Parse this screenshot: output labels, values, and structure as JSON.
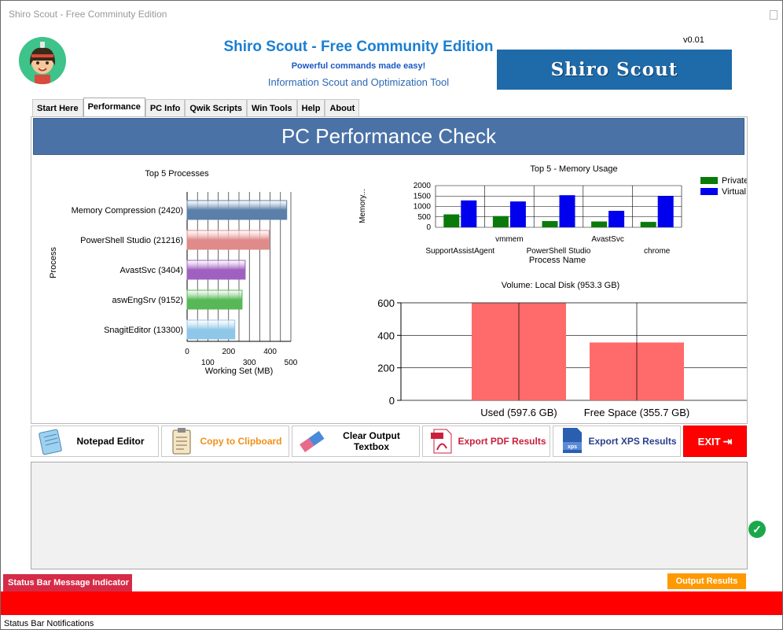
{
  "window": {
    "title": "Shiro Scout - Free Comminuty Edition"
  },
  "header": {
    "title": "Shiro Scout - Free Community Edition",
    "subtitle": "Powerful commands made easy!",
    "description": "Information Scout and Optimization Tool",
    "version": "v0.01",
    "brand": "Shiro Scout"
  },
  "tabs": [
    {
      "label": "Start Here",
      "active": false
    },
    {
      "label": "Performance",
      "active": true
    },
    {
      "label": "PC Info",
      "active": false
    },
    {
      "label": "Qwik Scripts",
      "active": false
    },
    {
      "label": "Win Tools",
      "active": false
    },
    {
      "label": "Help",
      "active": false
    },
    {
      "label": "About",
      "active": false
    }
  ],
  "panel": {
    "banner": "PC Performance Check"
  },
  "chart_data": [
    {
      "type": "bar",
      "orientation": "horizontal",
      "title": "Top 5 Processes",
      "xlabel": "Working Set (MB)",
      "ylabel": "Process",
      "categories": [
        "Memory Compression (2420)",
        "PowerShell Studio (21216)",
        "AvastSvc (3404)",
        "aswEngSrv (9152)",
        "SnagitEditor (13300)"
      ],
      "values": [
        480,
        395,
        280,
        265,
        230
      ],
      "colors": [
        "#5a7fa8",
        "#e08a8a",
        "#a060c0",
        "#58b858",
        "#8fc7e8"
      ],
      "xlim": [
        0,
        500
      ],
      "xticks_top": [
        "0",
        "200",
        "400"
      ],
      "xticks_bottom": [
        "100",
        "300",
        "500"
      ]
    },
    {
      "type": "bar",
      "title": "Top 5 - Memory Usage",
      "xlabel": "Process Name",
      "ylabel": "Memory...",
      "categories": [
        "SupportAssistAgent",
        "vmmem",
        "PowerShell Studio",
        "AvastSvc",
        "chrome"
      ],
      "series": [
        {
          "name": "Private",
          "color": "#0a7a0a",
          "values": [
            620,
            540,
            300,
            280,
            260
          ]
        },
        {
          "name": "Virtual",
          "color": "#0000ee",
          "values": [
            1290,
            1240,
            1540,
            790,
            1500
          ]
        }
      ],
      "ylim": [
        0,
        2000
      ],
      "yticks": [
        "2000",
        "1500",
        "1000",
        "500",
        "0"
      ],
      "legend": "top-right"
    },
    {
      "type": "bar",
      "title": "Volume: Local Disk (953.3 GB)",
      "categories": [
        "Used (597.6 GB)",
        "Free Space (355.7 GB)"
      ],
      "values": [
        597.6,
        355.7
      ],
      "color": "#ff6a6a",
      "ylim": [
        0,
        600
      ],
      "yticks": [
        "600",
        "400",
        "200",
        "0"
      ]
    }
  ],
  "buttons": {
    "notepad": {
      "label": "Notepad Editor",
      "color": "#000000"
    },
    "clipboard": {
      "label": "Copy to Clipboard",
      "color": "#f0901a"
    },
    "clear": {
      "label": "Clear Output Textbox",
      "color": "#000000"
    },
    "pdf": {
      "label": "Export PDF Results",
      "color": "#c8203c"
    },
    "xps": {
      "label": "Export XPS Results",
      "color": "#2a3f8a"
    },
    "exit": {
      "label": "EXIT",
      "color": "#ffffff"
    }
  },
  "status": {
    "indicator": "Status Bar Message Indicator",
    "output_results": "Output Results",
    "notifications": "Status Bar Notifications"
  }
}
